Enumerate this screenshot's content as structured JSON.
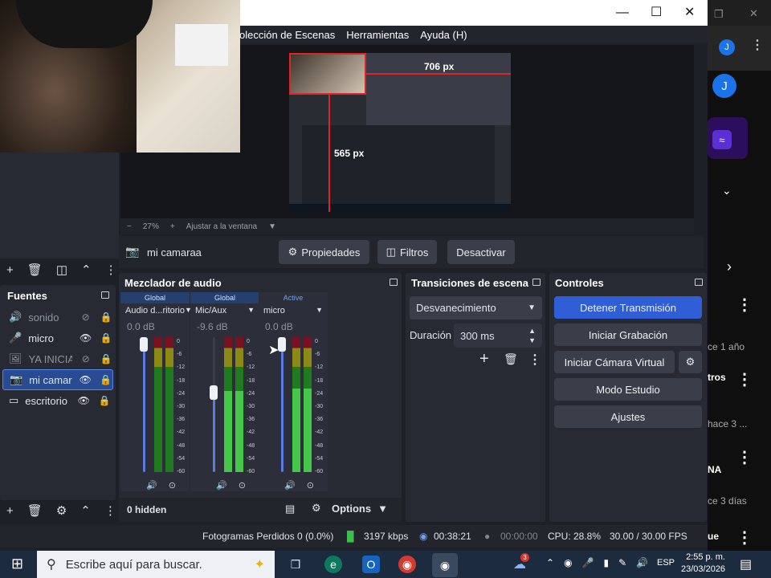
{
  "obs": {
    "menu": [
      "olección de Escenas",
      "Herramientas",
      "Ayuda (H)"
    ],
    "preview": {
      "width_label": "706 px",
      "height_label": "565 px",
      "zoom": "27%",
      "fit_label": "Ajustar a la ventana"
    },
    "source_toolbar": {
      "selected_source": "mi camaraa",
      "properties": "Propiedades",
      "filters": "Filtros",
      "deactivate": "Desactivar"
    },
    "sources": {
      "title": "Fuentes",
      "items": [
        {
          "name": "sonido",
          "visible": false,
          "icon": "speaker-icon"
        },
        {
          "name": "micro",
          "visible": true,
          "icon": "microphone-icon"
        },
        {
          "name": "YA INICIA",
          "visible": false,
          "icon": "image-icon"
        },
        {
          "name": "mi camara",
          "visible": true,
          "icon": "camera-icon",
          "selected": true
        },
        {
          "name": "escritorio",
          "visible": true,
          "icon": "monitor-icon"
        }
      ]
    },
    "mixer": {
      "title": "Mezclador de audio",
      "channels": [
        {
          "tag": "Global",
          "name": "Audio d...ritorio",
          "db": "0.0 dB",
          "volume": 1.0,
          "level": 0.0
        },
        {
          "tag": "Global",
          "name": "Mic/Aux",
          "db": "-9.6 dB",
          "volume": 0.6,
          "level": 0.6
        },
        {
          "tag": "Active",
          "name": "micro",
          "db": "0.0 dB",
          "volume": 1.0,
          "level": 0.62
        }
      ],
      "scale": [
        "0",
        "-6",
        "-12",
        "-18",
        "-24",
        "-30",
        "-36",
        "-42",
        "-48",
        "-54",
        "-60"
      ],
      "hidden": "0 hidden",
      "options": "Options"
    },
    "transitions": {
      "title": "Transiciones de escena",
      "selected": "Desvanecimiento",
      "duration_label": "Duración",
      "duration_value": "300 ms"
    },
    "controls": {
      "title": "Controles",
      "buttons": [
        "Detener Transmisión",
        "Iniciar Grabación",
        "Iniciar Cámara Virtual",
        "Modo Estudio",
        "Ajustes"
      ],
      "accent": "#2f5ed6"
    },
    "status": {
      "dropped": "Fotogramas Perdidos 0 (0.0%)",
      "bitrate": "3197 kbps",
      "stream_time": "00:38:21",
      "rec_time": "00:00:00",
      "cpu": "CPU: 28.8%",
      "fps": "30.00 / 30.00 FPS"
    }
  },
  "browser": {
    "avatar_letter": "J",
    "items": [
      {
        "meta": "ce 1 año"
      },
      {
        "title": "tros",
        "meta": "hace 3 ..."
      },
      {
        "title": "NA",
        "meta": "ce 3 días"
      },
      {
        "title": "ue"
      }
    ]
  },
  "taskbar": {
    "search_placeholder": "Escribe aquí para buscar.",
    "notification_count": "3",
    "lang": "ESP",
    "time": "2:55 p. m.",
    "date": "23/03/2026"
  }
}
